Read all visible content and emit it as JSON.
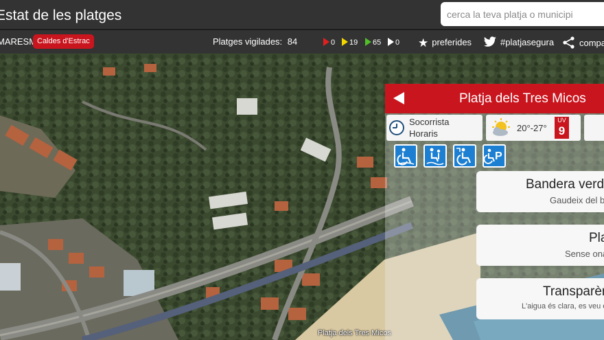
{
  "header": {
    "title": "Estat de les platges",
    "search_placeholder": "cerca la teva platja o municipi"
  },
  "subbar": {
    "region": "MARESME",
    "town": "Caldes d'Estrac",
    "vigilades_label": "Platges vigilades:",
    "vigilades_count": "84",
    "flags": [
      {
        "color": "#e02020",
        "count": "0"
      },
      {
        "color": "#f2d600",
        "count": "19"
      },
      {
        "color": "#4fbf2a",
        "count": "65"
      },
      {
        "color": "#ffffff",
        "count": "0"
      }
    ],
    "favorites_label": "preferides",
    "favorites_icon": "star-icon",
    "hashtag_label": "#platjasegura",
    "hashtag_icon": "twitter-bird-icon",
    "share_label": "compartir",
    "share_icon": "share-icon"
  },
  "map": {
    "beach_label": "Platja dels Tres Micos"
  },
  "panel": {
    "beach_name": "Platja dels Tres Micos",
    "lifeguard_line1": "Socorrista",
    "lifeguard_line2": "Horaris",
    "temperature": "20°-27°",
    "uv_label": "UV",
    "uv_value": "9",
    "accessibility_icons": [
      "wheelchair-access-icon",
      "assisted-bathing-icon",
      "accessible-beach-icon",
      "accessible-parking-icon"
    ],
    "cards": [
      {
        "title": "Bandera verda",
        "subtitle": "Gaudeix del bany"
      },
      {
        "title": "Platja",
        "subtitle": "Sense onatge"
      },
      {
        "title": "Transparència",
        "subtitle": "L'aigua és clara, es veu el fons"
      }
    ]
  },
  "colors": {
    "brand_red": "#c9151e",
    "bar_dark": "#333333",
    "access_blue": "#1d7fd1"
  }
}
